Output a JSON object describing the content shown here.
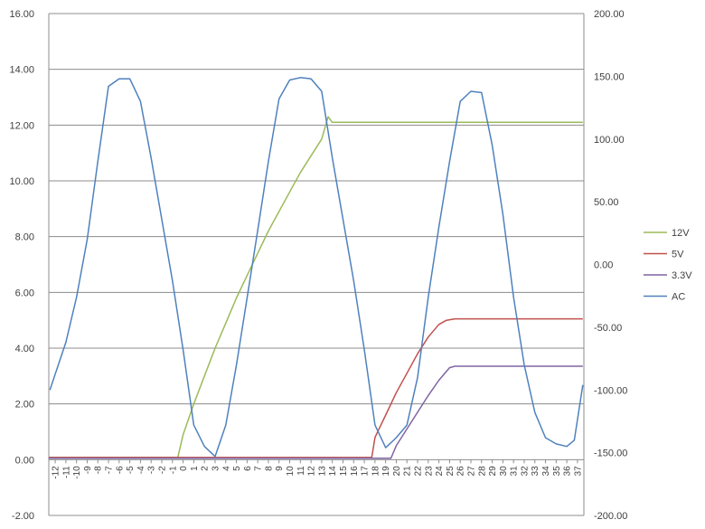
{
  "chart_data": {
    "type": "line",
    "title": "",
    "xlabel": "",
    "ylabel": "",
    "y2label": "",
    "x_categories": [
      "-12",
      "-11",
      "-10",
      "-9",
      "-8",
      "-7",
      "-6",
      "-5",
      "-4",
      "-3",
      "-2",
      "-1",
      "0",
      "1",
      "2",
      "3",
      "4",
      "5",
      "6",
      "7",
      "8",
      "9",
      "10",
      "11",
      "12",
      "13",
      "14",
      "15",
      "16",
      "17",
      "18",
      "19",
      "20",
      "21",
      "22",
      "23",
      "24",
      "25",
      "26",
      "27",
      "28",
      "29",
      "30",
      "31",
      "32",
      "33",
      "34",
      "35",
      "36",
      "37"
    ],
    "ylim": [
      -2,
      16
    ],
    "y_ticks": [
      "-2.00",
      "0.00",
      "2.00",
      "4.00",
      "6.00",
      "8.00",
      "10.00",
      "12.00",
      "14.00",
      "16.00"
    ],
    "y2lim": [
      -200,
      200
    ],
    "y2_ticks": [
      "-200.00",
      "-150.00",
      "-100.00",
      "-50.00",
      "0.00",
      "50.00",
      "100.00",
      "150.00",
      "200.00"
    ],
    "grid": true,
    "legend_position": "right",
    "series": [
      {
        "name": "12V",
        "color": "#9BBB59",
        "axis": "left",
        "x": [
          -12.6,
          -0.5,
          0,
          1,
          2,
          3,
          4,
          5,
          6,
          7,
          8,
          9,
          10,
          11,
          12,
          13,
          13.6,
          14,
          37.5
        ],
        "y": [
          0.08,
          0.08,
          0.9,
          2.0,
          3.0,
          4.0,
          4.9,
          5.8,
          6.6,
          7.4,
          8.2,
          8.9,
          9.6,
          10.3,
          10.9,
          11.5,
          12.3,
          12.1,
          12.1
        ]
      },
      {
        "name": "5V",
        "color": "#C0504D",
        "axis": "left",
        "x": [
          -12.6,
          17.7,
          18.0,
          18.5,
          19,
          20,
          21,
          22,
          23,
          24,
          24.7,
          25.5,
          37.5
        ],
        "y": [
          0.08,
          0.08,
          0.8,
          1.2,
          1.6,
          2.4,
          3.1,
          3.8,
          4.4,
          4.85,
          5.0,
          5.05,
          5.05
        ]
      },
      {
        "name": "3.3V",
        "color": "#8064A2",
        "axis": "left",
        "x": [
          -12.6,
          19.5,
          20,
          21,
          22,
          23,
          24,
          25,
          25.5,
          37.5
        ],
        "y": [
          0.05,
          0.05,
          0.5,
          1.1,
          1.7,
          2.3,
          2.85,
          3.3,
          3.35,
          3.35
        ]
      },
      {
        "name": "AC",
        "color": "#4F81BD",
        "axis": "right",
        "x": [
          -12.5,
          -11,
          -10,
          -9,
          -8,
          -7,
          -6,
          -5,
          -4,
          -3,
          -2,
          -1,
          0,
          1,
          2,
          3,
          4,
          5,
          6,
          7,
          8,
          9,
          10,
          11,
          12,
          13,
          14,
          15,
          16,
          17,
          18,
          19,
          20,
          21,
          22,
          23,
          24,
          25,
          26,
          27,
          28,
          29,
          30,
          31,
          32,
          33,
          34,
          35,
          36,
          36.7,
          37.5
        ],
        "y": [
          -100,
          -62,
          -26,
          20,
          82,
          142,
          148,
          148,
          130,
          85,
          36,
          -13,
          -68,
          -128,
          -145,
          -153,
          -128,
          -80,
          -27,
          27,
          82,
          132,
          147,
          149,
          148,
          138,
          85,
          36,
          -13,
          -68,
          -128,
          -146,
          -138,
          -128,
          -90,
          -26,
          30,
          82,
          130,
          138,
          137,
          95,
          40,
          -26,
          -80,
          -118,
          -138,
          -143,
          -145,
          -140,
          -96
        ]
      }
    ]
  }
}
